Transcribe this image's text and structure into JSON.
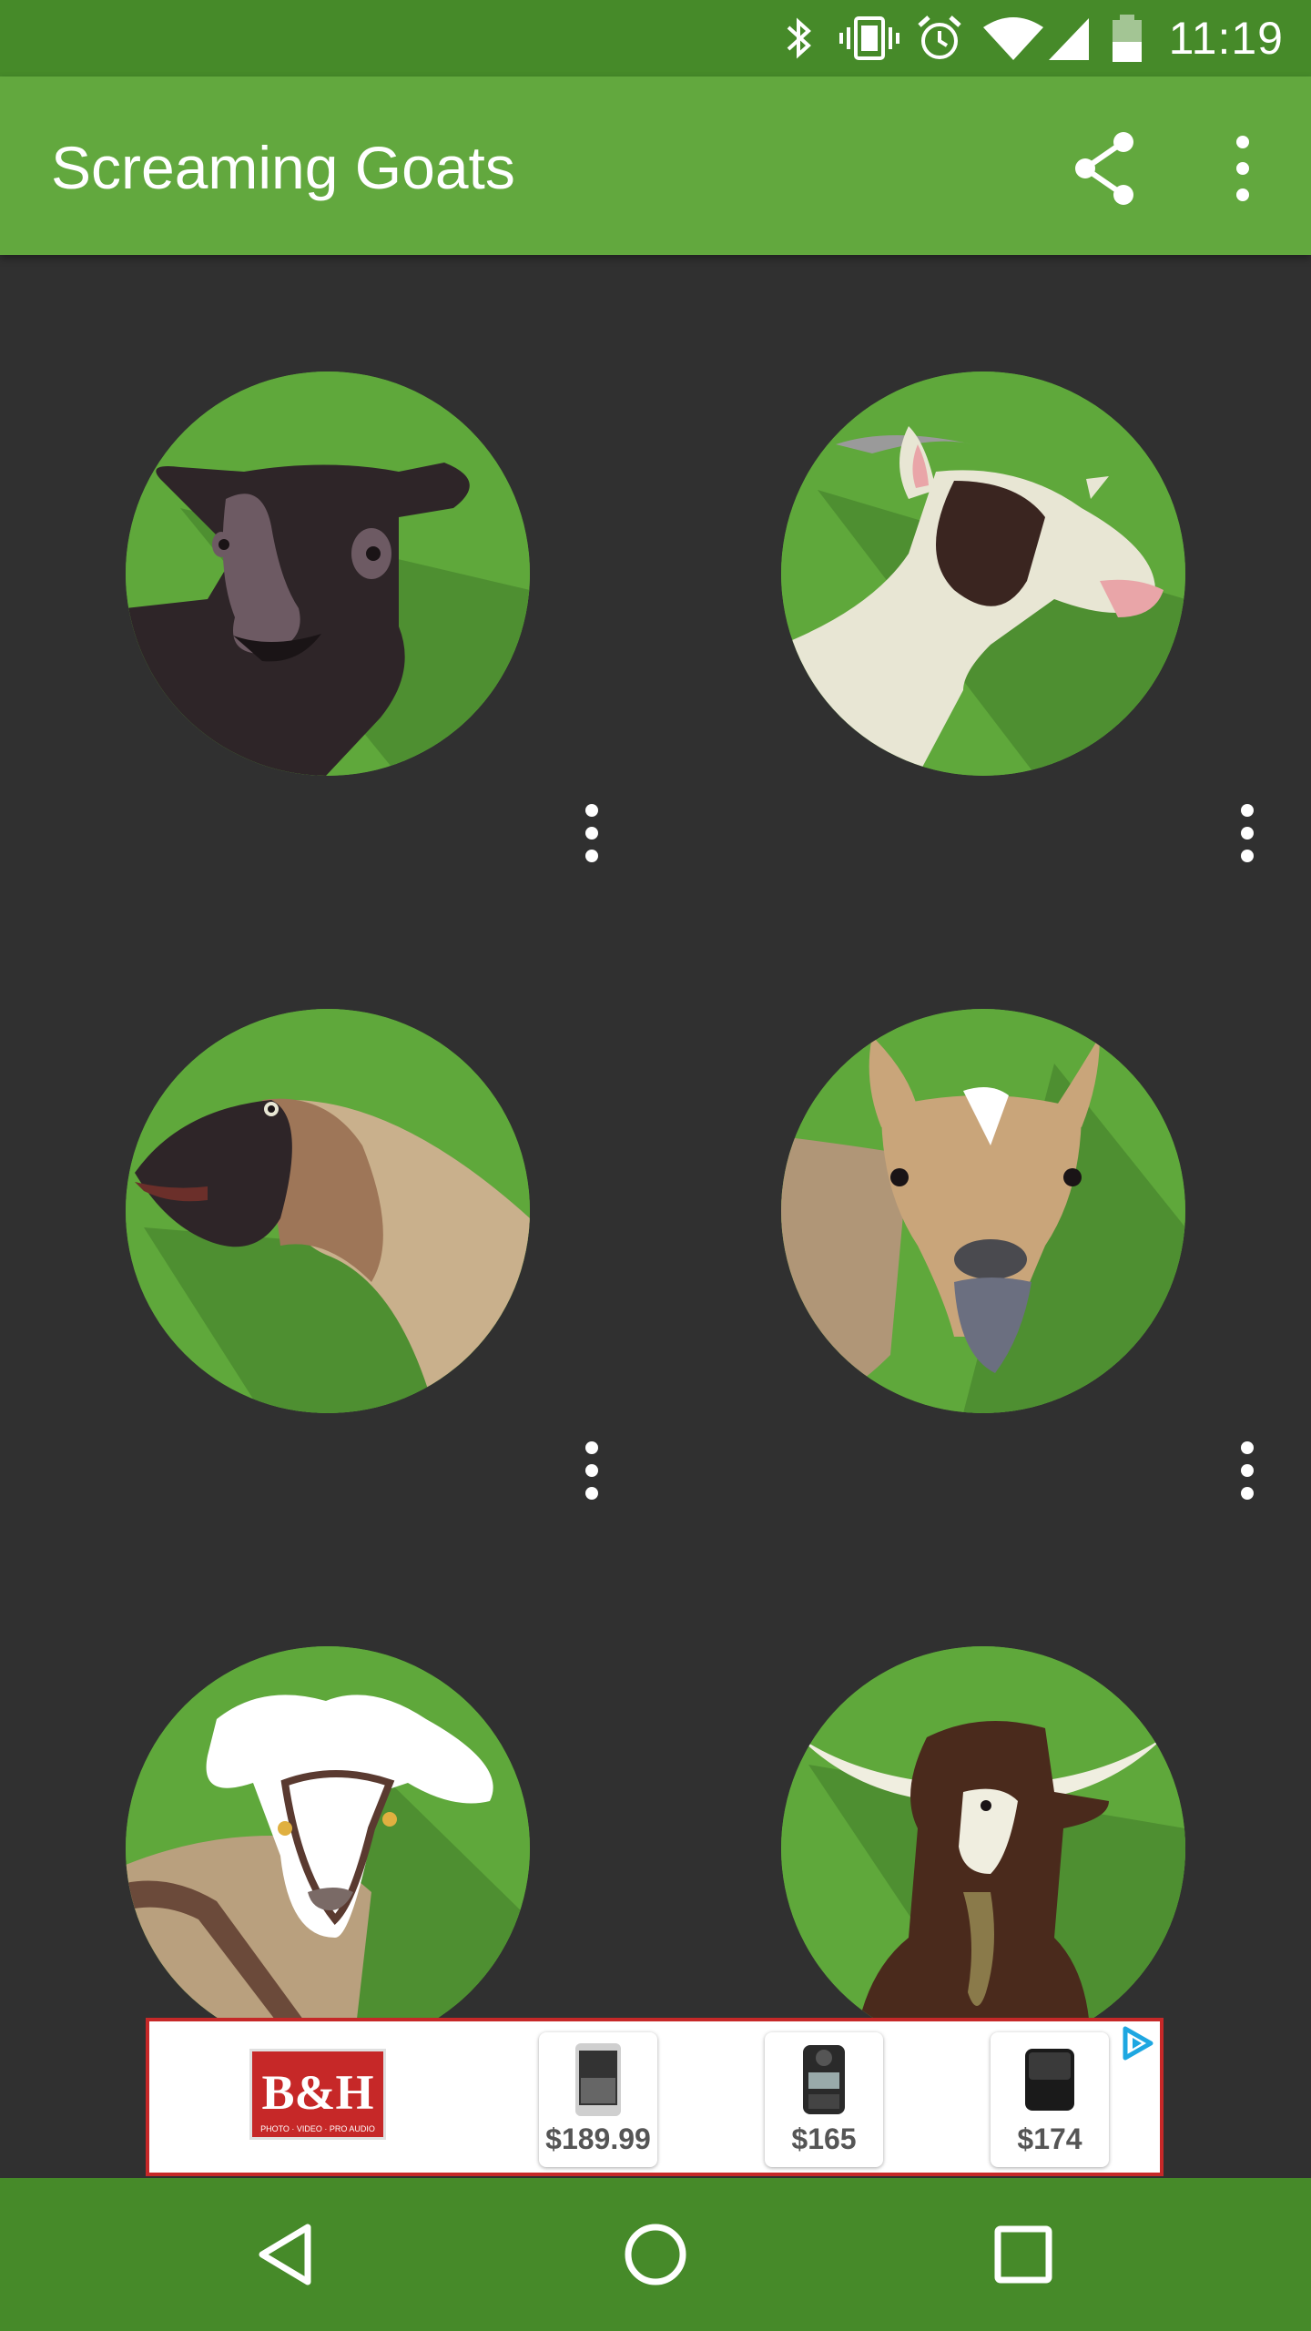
{
  "status_bar": {
    "time": "11:19",
    "icons": [
      "bluetooth-icon",
      "vibrate-icon",
      "alarm-icon",
      "wifi-icon",
      "signal-icon",
      "battery-icon"
    ]
  },
  "app_bar": {
    "title": "Screaming Goats",
    "actions": [
      "share-icon",
      "more-vert-icon"
    ]
  },
  "goats": [
    {
      "name": "goat-1",
      "menu_icon": "more-vert-icon"
    },
    {
      "name": "goat-2",
      "menu_icon": "more-vert-icon"
    },
    {
      "name": "goat-3",
      "menu_icon": "more-vert-icon"
    },
    {
      "name": "goat-4",
      "menu_icon": "more-vert-icon"
    },
    {
      "name": "goat-5",
      "menu_icon": "more-vert-icon"
    },
    {
      "name": "goat-6",
      "menu_icon": "more-vert-icon"
    }
  ],
  "ad": {
    "logo": "B&H",
    "logo_tagline": "PHOTO · VIDEO · PRO AUDIO",
    "products": [
      {
        "price": "$189.99"
      },
      {
        "price": "$165"
      },
      {
        "price": "$174"
      }
    ],
    "choices_icon": "ad-choices-icon"
  },
  "nav_bar": {
    "buttons": [
      "back-icon",
      "home-icon",
      "recents-icon"
    ]
  },
  "colors": {
    "status_bar": "#468a29",
    "app_bar": "#62a83e",
    "background": "#303030",
    "circle_green": "#5fa83b",
    "circle_shadow": "#4e8f31"
  }
}
